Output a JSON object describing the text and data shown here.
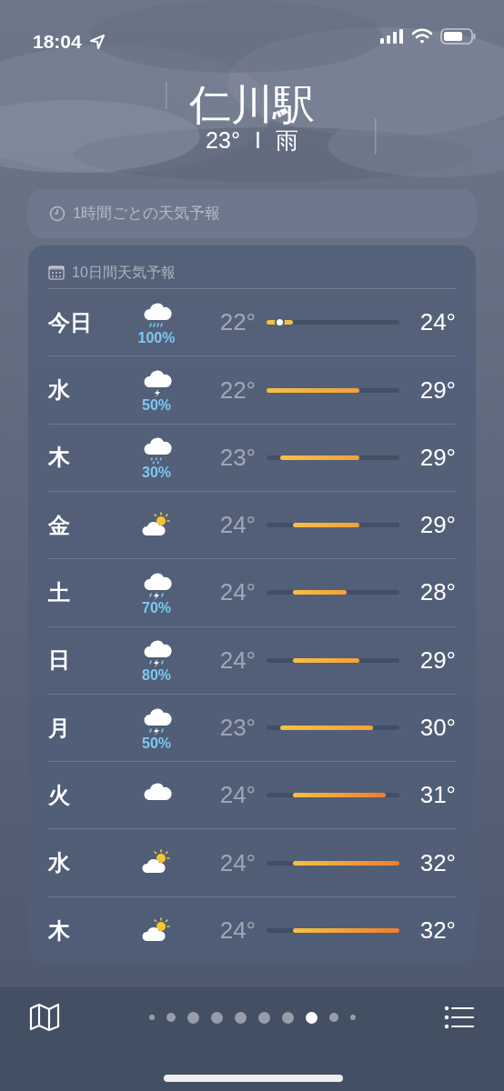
{
  "status_bar": {
    "time": "18:04"
  },
  "location": {
    "name": "仁川駅",
    "temperature": "23°",
    "separator": "I",
    "condition": "雨"
  },
  "hourly": {
    "title": "1時間ごとの天気予報"
  },
  "daily": {
    "title": "10日間天気予報",
    "rows": [
      {
        "day": "今日",
        "kind": "rain",
        "precip": "100%",
        "low": "22°",
        "high": "24°",
        "current_dot": true
      },
      {
        "day": "水",
        "kind": "thunder",
        "precip": "50%",
        "low": "22°",
        "high": "29°",
        "current_dot": false
      },
      {
        "day": "木",
        "kind": "drizzle",
        "precip": "30%",
        "low": "23°",
        "high": "29°",
        "current_dot": false
      },
      {
        "day": "金",
        "kind": "partly_sunny",
        "low": "24°",
        "high": "29°",
        "current_dot": false
      },
      {
        "day": "土",
        "kind": "thunder_rain",
        "precip": "70%",
        "low": "24°",
        "high": "28°",
        "current_dot": false
      },
      {
        "day": "日",
        "kind": "thunder_rain",
        "precip": "80%",
        "low": "24°",
        "high": "29°",
        "current_dot": false
      },
      {
        "day": "月",
        "kind": "thunder_rain",
        "precip": "50%",
        "low": "23°",
        "high": "30°",
        "current_dot": false
      },
      {
        "day": "火",
        "kind": "cloud",
        "low": "24°",
        "high": "31°",
        "current_dot": false
      },
      {
        "day": "水",
        "kind": "partly_sunny",
        "low": "24°",
        "high": "32°",
        "current_dot": false
      },
      {
        "day": "木",
        "kind": "partly_sunny",
        "low": "24°",
        "high": "32°",
        "current_dot": false
      }
    ]
  },
  "page_dots": [
    {
      "kind": "small",
      "selected": false
    },
    {
      "kind": "medium",
      "selected": false
    },
    {
      "kind": "normal",
      "selected": false
    },
    {
      "kind": "normal",
      "selected": false
    },
    {
      "kind": "normal",
      "selected": false
    },
    {
      "kind": "normal",
      "selected": false
    },
    {
      "kind": "normal",
      "selected": false
    },
    {
      "kind": "normal",
      "selected": true
    },
    {
      "kind": "medium",
      "selected": false
    },
    {
      "kind": "small",
      "selected": false
    }
  ]
}
